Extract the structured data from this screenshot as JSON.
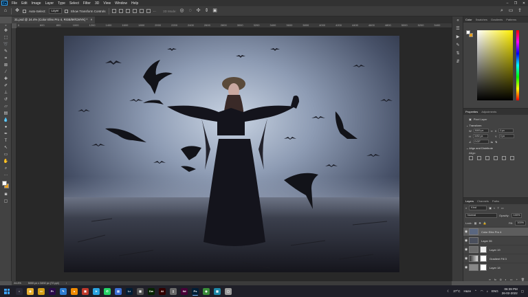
{
  "menubar": {
    "logo": "Ps",
    "items": [
      "File",
      "Edit",
      "Image",
      "Layer",
      "Type",
      "Select",
      "Filter",
      "3D",
      "View",
      "Window",
      "Help"
    ],
    "window_controls": [
      "–",
      "❐",
      "✕"
    ]
  },
  "options": {
    "auto_select_label": "Auto-Select:",
    "auto_select_target": "Layer",
    "show_transform_label": "Show Transform Controls",
    "mode_3d_label": "3D Mode:"
  },
  "document": {
    "tab_title": "31.psd @ 24.4% (Color Efex Pro 4, RGB/8#/CMYK) *",
    "close_glyph": "×"
  },
  "ruler": {
    "ticks": [
      "0",
      "600",
      "800",
      "1000",
      "1200",
      "1400",
      "1600",
      "1800",
      "2000",
      "2200",
      "2400",
      "2600",
      "2800",
      "3000",
      "3200",
      "3400",
      "3600",
      "3800",
      "4000",
      "4200",
      "4400",
      "4600",
      "4800",
      "5000",
      "5200",
      "5400"
    ]
  },
  "color_panel": {
    "tabs": [
      "Color",
      "Swatches",
      "Gradients",
      "Patterns"
    ],
    "fg_color": "#ffffff",
    "bg_color": "#e8a020"
  },
  "properties_panel": {
    "tabs": [
      "Properties",
      "Adjustments"
    ],
    "layer_kind": "Pixel Layer",
    "transform_label": "Transform",
    "w_label": "W",
    "w_value": "5000 px",
    "x_label": "X",
    "x_value": "0 px",
    "h_label": "H",
    "h_value": "3492 px",
    "y_label": "Y",
    "y_value": "0 px",
    "angle_value": "0.00°",
    "align_label": "Align and Distribute",
    "align_sub": "Align:"
  },
  "layers_panel": {
    "tabs": [
      "Layers",
      "Channels",
      "Paths"
    ],
    "filter_kind": "Kind",
    "blend_mode": "Normal",
    "opacity_label": "Opacity:",
    "opacity_value": "100%",
    "lock_label": "Lock:",
    "fill_label": "Fill:",
    "fill_value": "100%",
    "layers": [
      {
        "name": "Color Efex Pro 4"
      },
      {
        "name": "Layer 35"
      },
      {
        "name": "Layer 19"
      },
      {
        "name": "Gradient Fill 3"
      },
      {
        "name": "Layer 18"
      }
    ]
  },
  "statusbar": {
    "zoom": "24.4%",
    "doc_size": "5000 px x 3492 px (72 ppi)"
  },
  "taskbar": {
    "apps": [
      {
        "icon": "search-app-icon",
        "label": "○",
        "color": "#2b2b38"
      },
      {
        "icon": "chrome-icon",
        "label": "◉",
        "color": "#e8b030"
      },
      {
        "icon": "explorer-icon",
        "label": "▭",
        "color": "#d4a017"
      },
      {
        "icon": "premiere-icon",
        "label": "Pr",
        "color": "#2a0a4a"
      },
      {
        "icon": "paint-icon",
        "label": "✎",
        "color": "#2d7dd2"
      },
      {
        "icon": "vlc-icon",
        "label": "▲",
        "color": "#f08a00"
      },
      {
        "icon": "app-red-icon",
        "label": "▣",
        "color": "#c0392b"
      },
      {
        "icon": "telegram-icon",
        "label": "➤",
        "color": "#2aa3df"
      },
      {
        "icon": "whatsapp-icon",
        "label": "✆",
        "color": "#25d366"
      },
      {
        "icon": "app-blue-icon",
        "label": "▤",
        "color": "#3b6fd4"
      },
      {
        "icon": "lightroom-icon",
        "label": "Lr",
        "color": "#001e36"
      },
      {
        "icon": "app-gray-icon",
        "label": "▦",
        "color": "#555555"
      },
      {
        "icon": "dreamweaver-icon",
        "label": "Dw",
        "color": "#072401"
      },
      {
        "icon": "illustrator-icon",
        "label": "Ai",
        "color": "#330000"
      },
      {
        "icon": "app-light-icon",
        "label": "▯",
        "color": "#6a6a6a"
      },
      {
        "icon": "xd-icon",
        "label": "Xd",
        "color": "#470137"
      },
      {
        "icon": "photoshop-icon",
        "label": "Ps",
        "color": "#001e36"
      },
      {
        "icon": "chrome2-icon",
        "label": "◉",
        "color": "#3a8d3a"
      },
      {
        "icon": "app-cyan-icon",
        "label": "▩",
        "color": "#1e88a8"
      },
      {
        "icon": "app-white-icon",
        "label": "▢",
        "color": "#9a9a9a"
      }
    ],
    "weather_temp": "27°C",
    "weather_text": "Haze",
    "lang": "ENG",
    "time": "06:39 PM",
    "date": "26-02-2022"
  }
}
